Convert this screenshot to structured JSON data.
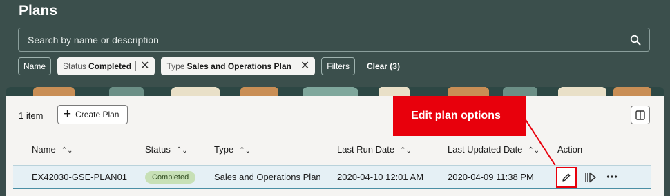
{
  "page": {
    "title": "Plans"
  },
  "search": {
    "placeholder": "Search by name or description"
  },
  "filters": {
    "name_chip": "Name",
    "status_chip": {
      "label": "Status",
      "value": "Completed"
    },
    "type_chip": {
      "label": "Type",
      "value": "Sales and Operations Plan"
    },
    "filters_chip": "Filters",
    "clear_label": "Clear (3)"
  },
  "toolbar": {
    "item_count": "1 item",
    "create_label": "Create Plan"
  },
  "callout": {
    "text": "Edit plan options",
    "color": "#e8000c"
  },
  "table": {
    "columns": [
      "Name",
      "Status",
      "Type",
      "Last Run Date",
      "Last Updated Date",
      "Action"
    ],
    "rows": [
      {
        "name": "EX42030-GSE-PLAN01",
        "status": "Completed",
        "type": "Sales and Operations Plan",
        "last_run": "2020-04-10 12:01 AM",
        "last_updated": "2020-04-09 11:38 PM",
        "actions": [
          "edit-icon",
          "run-icon",
          "more-icon"
        ]
      }
    ]
  },
  "colors": {
    "header_bg": "#3b4f4c",
    "panel_bg": "#f5f4f2",
    "row_selected": "#e5f0f5",
    "status_badge": "#c7e0b6"
  }
}
